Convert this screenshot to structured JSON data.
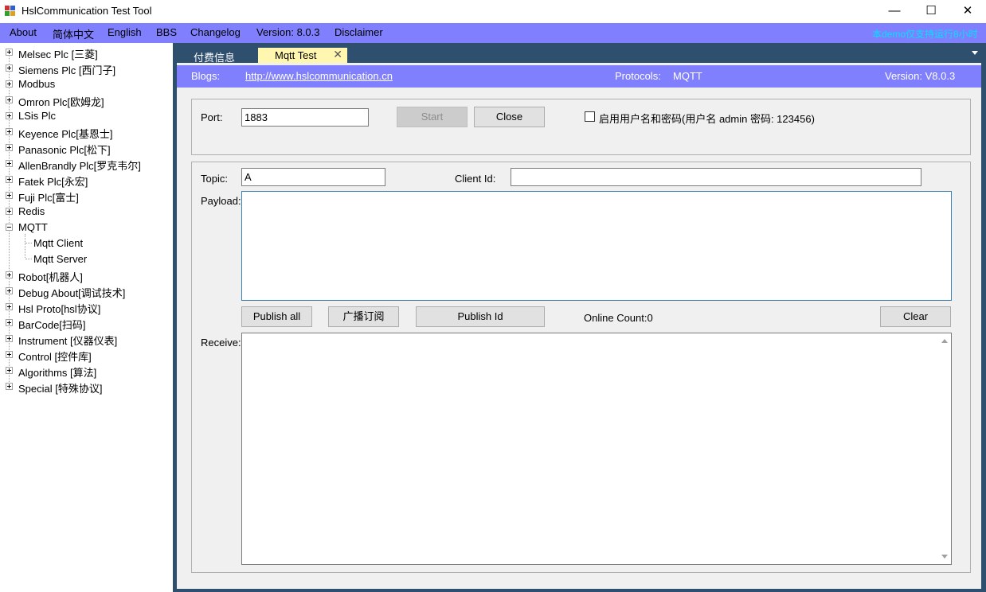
{
  "window": {
    "title": "HslCommunication Test Tool",
    "minimize": "—",
    "maximize": "☐",
    "close": "✕"
  },
  "menu": {
    "items": [
      "About",
      "简体中文",
      "English",
      "BBS",
      "Changelog",
      "Version: 8.0.3",
      "Disclaimer"
    ],
    "marquee": "本demo仅支持运行8小时"
  },
  "tree": {
    "nodes": [
      {
        "label": "Melsec Plc [三菱]",
        "expanded": false
      },
      {
        "label": "Siemens Plc [西门子]",
        "expanded": false
      },
      {
        "label": "Modbus",
        "expanded": false
      },
      {
        "label": "Omron Plc[欧姆龙]",
        "expanded": false
      },
      {
        "label": "LSis Plc",
        "expanded": false
      },
      {
        "label": "Keyence Plc[基恩士]",
        "expanded": false
      },
      {
        "label": "Panasonic Plc[松下]",
        "expanded": false
      },
      {
        "label": "AllenBrandly Plc[罗克韦尔]",
        "expanded": false
      },
      {
        "label": "Fatek Plc[永宏]",
        "expanded": false
      },
      {
        "label": "Fuji Plc[富士]",
        "expanded": false
      },
      {
        "label": "Redis",
        "expanded": false
      },
      {
        "label": "MQTT",
        "expanded": true
      },
      {
        "label": "Robot[机器人]",
        "expanded": false
      },
      {
        "label": "Debug About[调试技术]",
        "expanded": false
      },
      {
        "label": "Hsl Proto[hsl协议]",
        "expanded": false
      },
      {
        "label": "BarCode[扫码]",
        "expanded": false
      },
      {
        "label": "Instrument [仪器仪表]",
        "expanded": false
      },
      {
        "label": "Control [控件库]",
        "expanded": false
      },
      {
        "label": "Algorithms [算法]",
        "expanded": false
      },
      {
        "label": "Special [特殊协议]",
        "expanded": false
      }
    ],
    "mqtt_children": [
      "Mqtt Client",
      "Mqtt Server"
    ]
  },
  "tabs": {
    "inactive": "付费信息",
    "active": "Mqtt Test",
    "close": "✕"
  },
  "info": {
    "blogs_label": "Blogs:",
    "blogs_url": "http://www.hslcommunication.cn",
    "protocols_label": "Protocols:",
    "protocols_value": "MQTT",
    "version": "Version: V8.0.3"
  },
  "server": {
    "port_label": "Port:",
    "port_value": "1883",
    "start": "Start",
    "close": "Close",
    "auth_label": "启用用户名和密码(用户名 admin  密码: 123456)",
    "auth_checked": false
  },
  "publish": {
    "topic_label": "Topic:",
    "topic_value": "A",
    "client_id_label": "Client Id:",
    "client_id_value": "",
    "payload_label": "Payload:",
    "payload_value": "",
    "publish_all": "Publish all",
    "broadcast": "广播订阅",
    "publish_id": "Publish Id",
    "online_count": "Online Count:0",
    "clear": "Clear",
    "receive_label": "Receive:",
    "receive_value": ""
  }
}
